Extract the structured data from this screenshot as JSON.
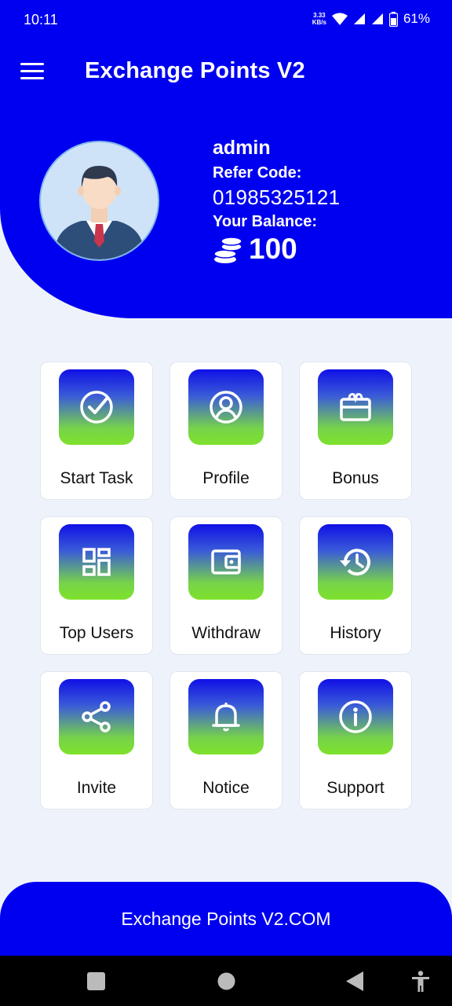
{
  "status_bar": {
    "time": "10:11",
    "net_speed_value": "3.33",
    "net_speed_unit": "KB/s",
    "battery": "61%"
  },
  "app_bar": {
    "title": "Exchange Points V2"
  },
  "profile": {
    "username": "admin",
    "refer_label": "Refer Code:",
    "refer_code": "01985325121",
    "balance_label": "Your Balance:",
    "balance_value": "100"
  },
  "menu": [
    {
      "label": "Start Task",
      "icon": "check-circle-icon"
    },
    {
      "label": "Profile",
      "icon": "user-circle-icon"
    },
    {
      "label": "Bonus",
      "icon": "gift-card-icon"
    },
    {
      "label": "Top Users",
      "icon": "dashboard-grid-icon"
    },
    {
      "label": "Withdraw",
      "icon": "wallet-icon"
    },
    {
      "label": "History",
      "icon": "history-clock-icon"
    },
    {
      "label": "Invite",
      "icon": "share-icon"
    },
    {
      "label": "Notice",
      "icon": "bell-icon"
    },
    {
      "label": "Support",
      "icon": "info-icon"
    }
  ],
  "footer": {
    "text": "Exchange Points V2.COM"
  },
  "colors": {
    "primary": "#0000F0",
    "tile_top": "#1010E6",
    "tile_bottom": "#7EE22C",
    "background": "#EEF3FB"
  }
}
